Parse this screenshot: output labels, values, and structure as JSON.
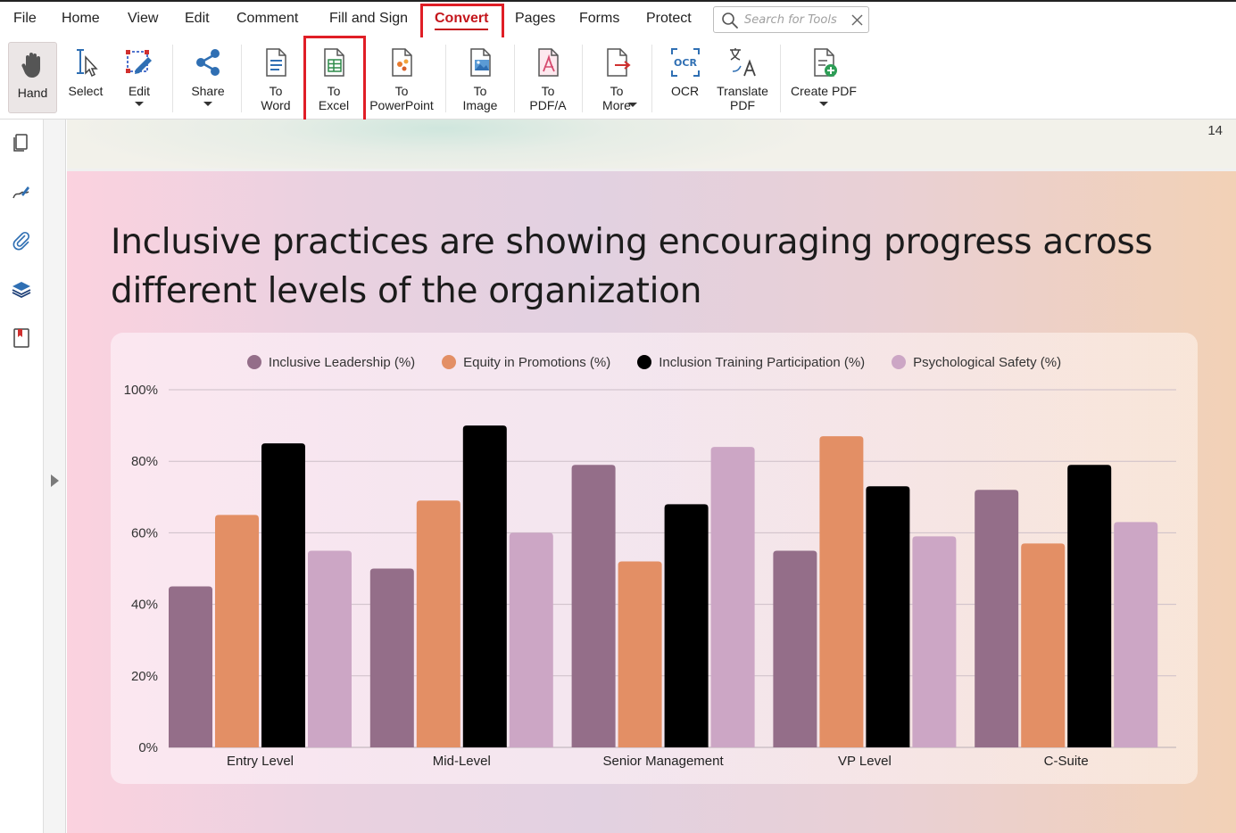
{
  "menu": {
    "items": [
      "File",
      "Home",
      "View",
      "Edit",
      "Comment",
      "Fill and Sign",
      "Convert",
      "Pages",
      "Forms",
      "Protect"
    ],
    "active": "Convert",
    "search_placeholder": "Search for Tools"
  },
  "toolbar": {
    "hand": "Hand",
    "select": "Select",
    "edit": "Edit",
    "share": "Share",
    "to_word": [
      "To",
      "Word"
    ],
    "to_excel": [
      "To",
      "Excel"
    ],
    "to_powerpoint": [
      "To",
      "PowerPoint"
    ],
    "to_image": [
      "To",
      "Image"
    ],
    "to_pdfa": [
      "To",
      "PDF/A"
    ],
    "to_more": [
      "To",
      "More"
    ],
    "ocr": "OCR",
    "ocr_icon_text": "OCR",
    "translate": [
      "Translate",
      "PDF"
    ],
    "create_pdf": "Create PDF"
  },
  "document": {
    "page_number": "14",
    "slide_title": "Inclusive practices are showing encouraging progress across different levels of the organization"
  },
  "colors": {
    "accent_red": "#c4161c",
    "series": [
      "#946e89",
      "#e38f65",
      "#000000",
      "#cca6c5"
    ]
  },
  "chart_data": {
    "type": "bar",
    "title": "",
    "xlabel": "",
    "ylabel": "",
    "categories": [
      "Entry Level",
      "Mid-Level",
      "Senior Management",
      "VP Level",
      "C-Suite"
    ],
    "series": [
      {
        "name": "Inclusive Leadership (%)",
        "values": [
          45,
          50,
          79,
          55,
          72
        ]
      },
      {
        "name": "Equity in Promotions (%)",
        "values": [
          65,
          69,
          52,
          87,
          57
        ]
      },
      {
        "name": "Inclusion Training Participation (%)",
        "values": [
          85,
          90,
          68,
          73,
          79
        ]
      },
      {
        "name": "Psychological Safety (%)",
        "values": [
          55,
          60,
          84,
          59,
          63
        ]
      }
    ],
    "yticks": [
      "0%",
      "20%",
      "40%",
      "60%",
      "80%",
      "100%"
    ],
    "ylim": [
      0,
      100
    ],
    "grid": true,
    "legend_position": "top-center"
  }
}
